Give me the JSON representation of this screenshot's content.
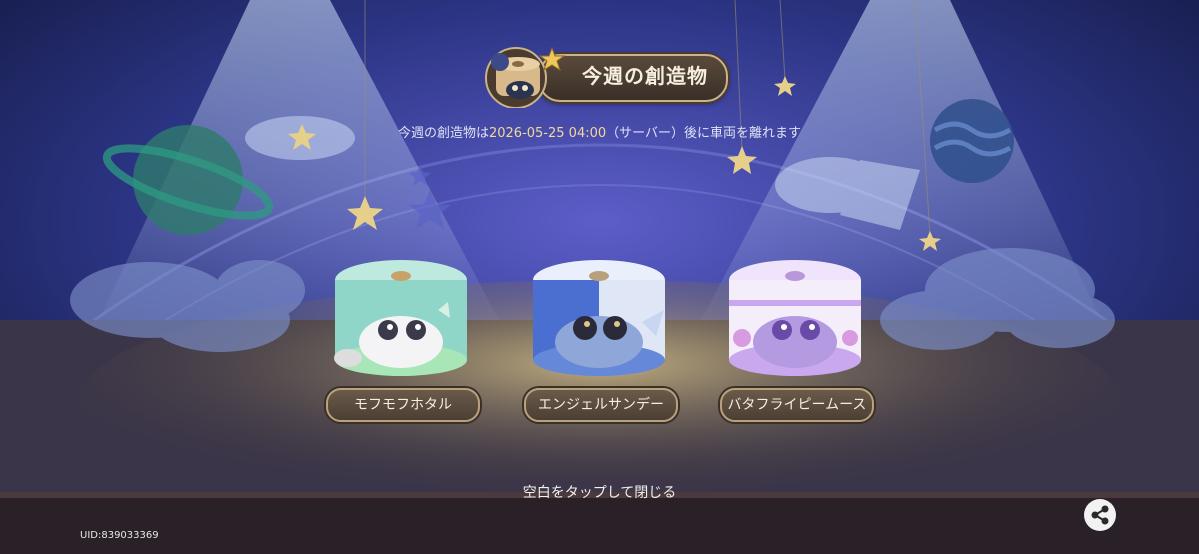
{
  "header": {
    "title": "今週の創造物",
    "subtitle_prefix": "今週の創造物は",
    "subtitle_datetime": "2026-05-25 04:00",
    "subtitle_suffix": "（サーバー）後に車両を離れます"
  },
  "creatures": [
    {
      "name": "モフモフホタル",
      "icon": "mint-cake-creature-icon",
      "color": "#8fd6c8"
    },
    {
      "name": "エンジェルサンデー",
      "icon": "blue-cake-creature-icon",
      "color": "#4a6fd0"
    },
    {
      "name": "バタフライピームース",
      "icon": "purple-cake-creature-icon",
      "color": "#c9a8ef"
    }
  ],
  "footer": {
    "close_hint": "空白をタップして閉じる",
    "uid": "UID:839033369",
    "share_icon": "share-icon"
  },
  "colors": {
    "background": "#1c2256",
    "accent_gold": "#f3d89a",
    "banner_brown": "#4b3f34"
  }
}
